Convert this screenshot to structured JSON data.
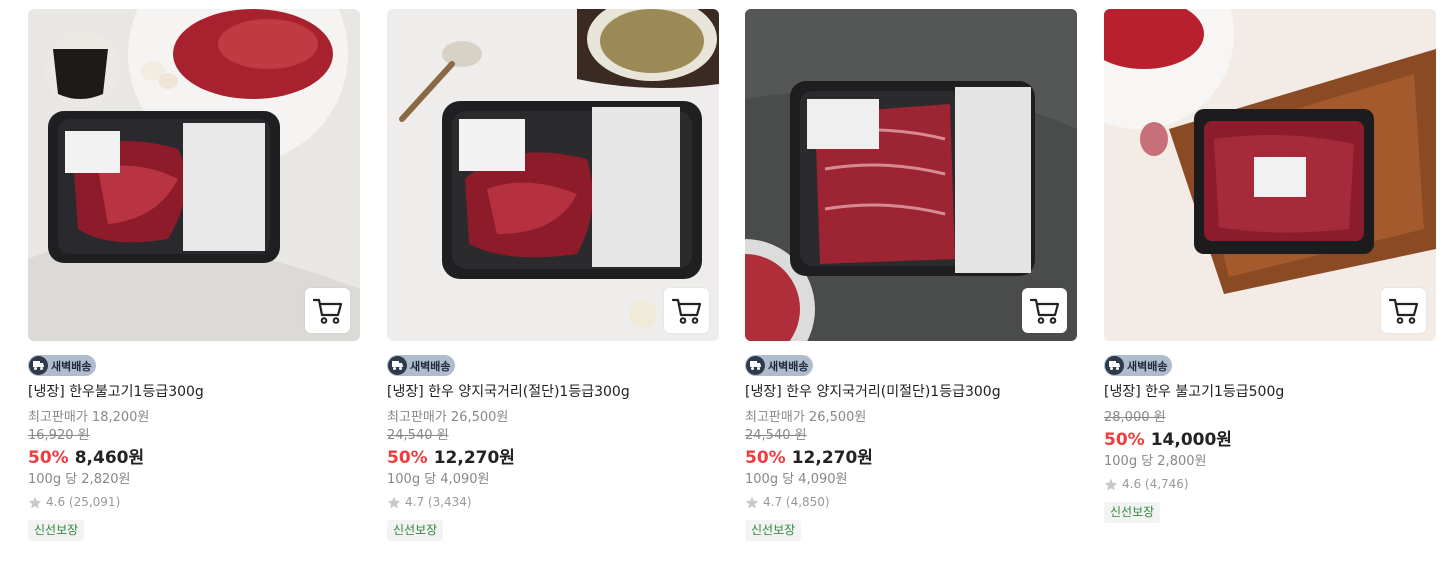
{
  "badge_label": "새벽배송",
  "products": [
    {
      "title": "[냉장] 한우불고기1등급300g",
      "max_price_label": "최고판매가 18,200원",
      "original_price": "16,920 원",
      "discount": "50%",
      "price": "8,460원",
      "unit_price": "100g 당 2,820원",
      "rating": "4.6 (25,091)",
      "tag": "신선보장"
    },
    {
      "title": "[냉장] 한우 양지국거리(절단)1등급300g",
      "max_price_label": "최고판매가 26,500원",
      "original_price": "24,540 원",
      "discount": "50%",
      "price": "12,270원",
      "unit_price": "100g 당 4,090원",
      "rating": "4.7 (3,434)",
      "tag": "신선보장"
    },
    {
      "title": "[냉장] 한우 양지국거리(미절단)1등급300g",
      "max_price_label": "최고판매가 26,500원",
      "original_price": "24,540 원",
      "discount": "50%",
      "price": "12,270원",
      "unit_price": "100g 당 4,090원",
      "rating": "4.7 (4,850)",
      "tag": "신선보장"
    },
    {
      "title": "[냉장] 한우 불고기1등급500g",
      "original_price": "28,000 원",
      "discount": "50%",
      "price": "14,000원",
      "unit_price": "100g 당 2,800원",
      "rating": "4.6 (4,746)",
      "tag": "신선보장"
    }
  ],
  "colors": {
    "discount": "#f03c3c",
    "fresh_tag": "#2e8b3a",
    "badge_bg": "#aebccd",
    "star": "#c8c8c8"
  },
  "icons": [
    "cart-icon",
    "truck-icon",
    "star-icon"
  ]
}
